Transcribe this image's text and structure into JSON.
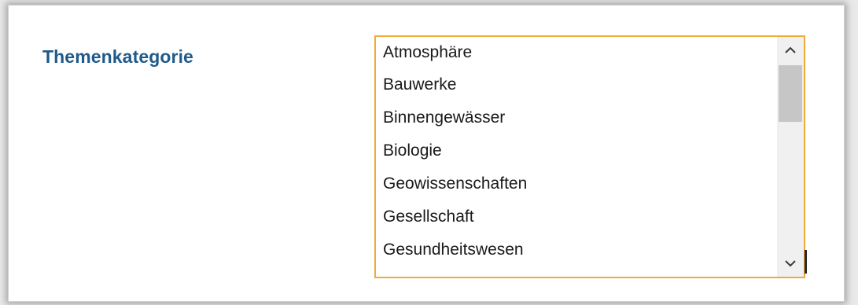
{
  "field": {
    "label": "Themenkategorie"
  },
  "listbox": {
    "options": [
      "Atmosphäre",
      "Bauwerke",
      "Binnengewässer",
      "Biologie",
      "Geowissenschaften",
      "Gesellschaft",
      "Gesundheitswesen"
    ],
    "scroll_position": 0.0
  },
  "colors": {
    "label": "#1f5a8a",
    "focus_border": "#f2a93b",
    "scrollbar_track": "#f0f0f0",
    "scrollbar_thumb": "#c6c6c6"
  },
  "icons": {
    "scroll_up": "chevron-up-icon",
    "scroll_down": "chevron-down-icon"
  }
}
